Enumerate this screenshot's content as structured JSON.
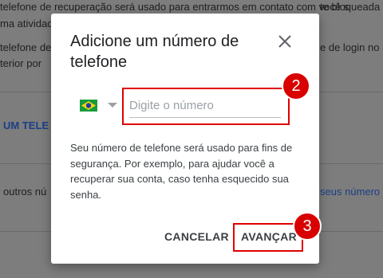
{
  "background": {
    "line1_left": "telefone de recuperação será usado para entrarmos em contato com você s",
    "line1_right": "te bloqueada",
    "line2_left": "ma atividade",
    "line3_left": "telefone de",
    "line3_right": "e de login no",
    "line4_left": "terior por",
    "link_left": "UM TELE",
    "line5_left": "outros nú",
    "link_right": "seus número"
  },
  "dialog": {
    "title": "Adicione um número de telefone",
    "phone_placeholder": "Digite o número",
    "phone_value": "",
    "description": "Seu número de telefone será usado para fins de segurança. Por exemplo, para ajudar você a recuperar sua conta, caso tenha esquecido sua senha.",
    "cancel_label": "CANCELAR",
    "next_label": "AVANÇAR",
    "country_flag": "brazil-flag-icon"
  },
  "annotations": {
    "step_input": "2",
    "step_next": "3",
    "highlight_color": "#e00000"
  }
}
